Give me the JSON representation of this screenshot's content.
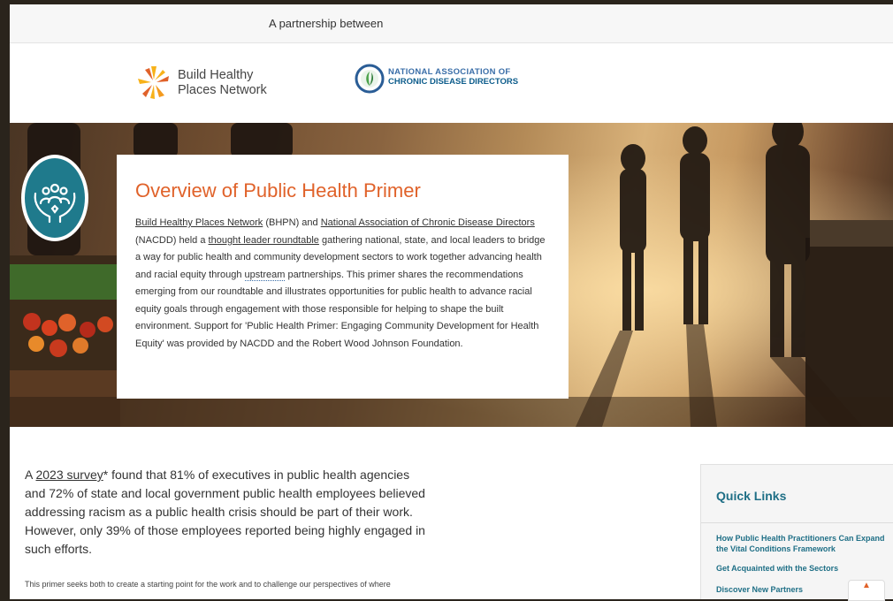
{
  "header": {
    "partnership_text": "A partnership between"
  },
  "logos": {
    "bhpn": {
      "line1": "Build Healthy",
      "line2": "Places Network"
    },
    "nacdd": {
      "line1": "NATIONAL ASSOCIATION OF",
      "line2": "CHRONIC DISEASE DIRECTORS"
    }
  },
  "hero": {
    "icon": "hands-community-icon",
    "title": "Overview of Public Health Primer",
    "link_bhpn": "Build Healthy Places Network",
    "text_1": " (BHPN) and ",
    "link_nacdd": "National Association of Chronic Disease Directors",
    "text_2": " (NACDD) held a ",
    "link_roundtable": "thought leader roundtable",
    "text_3": " gathering national, state, and local leaders to bridge a way for public health and community development sectors to work together advancing health and racial equity through ",
    "link_upstream": "upstream",
    "text_4": " partnerships. This primer shares the recommendations emerging from our roundtable and illustrates opportunities for public health to advance racial equity goals through engagement with those responsible for helping to shape the built environment. Support for 'Public Health Primer: Engaging Community Development for Health Equity' was provided by NACDD and the Robert Wood Johnson Foundation."
  },
  "main": {
    "lead_prefix": "A ",
    "lead_link": "2023 survey",
    "lead_text": "* found that 81% of executives in public health agencies and 72% of state and local government public health employees believed addressing racism as a public health crisis should be part of their work. However, only 39% of those employees reported being highly engaged in such efforts.",
    "sub_text": "This primer seeks both to create a starting point for the work and to challenge our perspectives of where"
  },
  "quick_links": {
    "title": "Quick Links",
    "items": [
      {
        "label": "How Public Health Practitioners Can Expand the Vital Conditions Framework"
      },
      {
        "label": "Get Acquainted with the Sectors"
      },
      {
        "label": "Discover New Partners"
      }
    ]
  },
  "colors": {
    "accent_orange": "#e0622a",
    "teal": "#1f7a8c",
    "link_teal": "#1f6f86"
  }
}
